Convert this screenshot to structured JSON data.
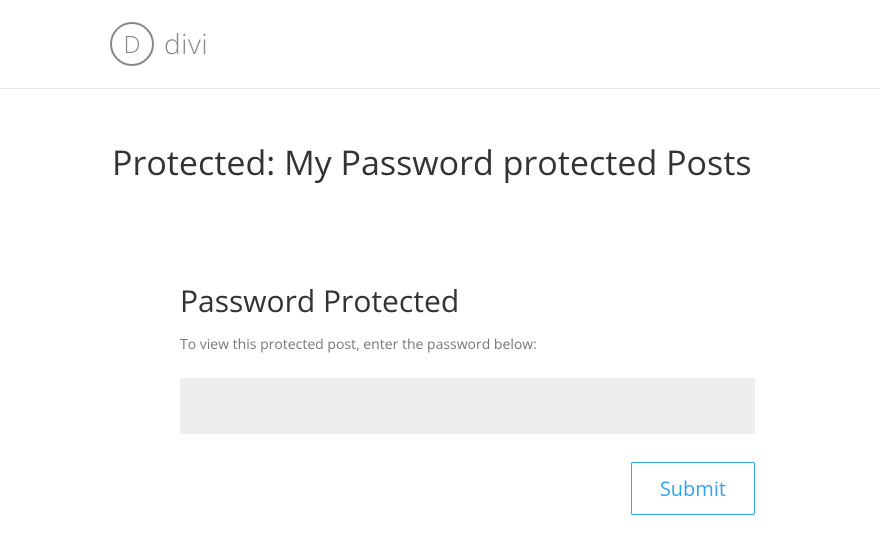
{
  "header": {
    "logo_letter": "D",
    "logo_text": "divi"
  },
  "main": {
    "page_title": "Protected: My Password protected Posts",
    "form": {
      "heading": "Password Protected",
      "instruction": "To view this protected post, enter the password below:",
      "password_value": "",
      "submit_label": "Submit"
    }
  },
  "colors": {
    "accent": "#2ea3f2",
    "text_primary": "#333333",
    "text_muted": "#777777",
    "input_bg": "#eeeeee",
    "border": "#e5e5e5"
  }
}
